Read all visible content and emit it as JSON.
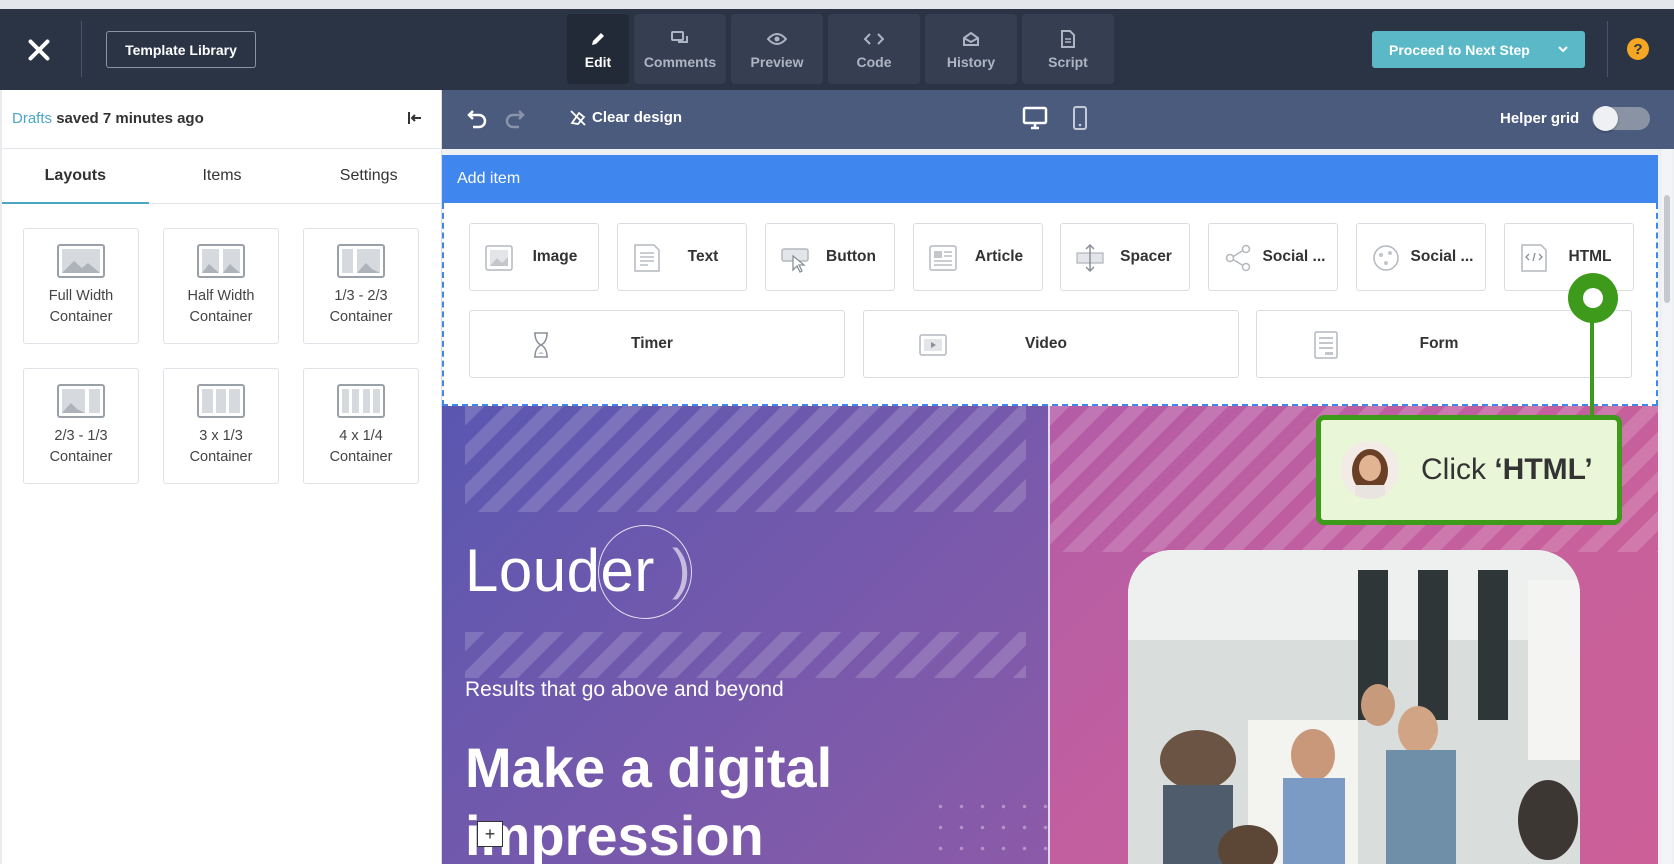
{
  "topbar": {
    "template_library": "Template Library",
    "tabs": [
      {
        "label": "Edit",
        "icon": "pencil-icon",
        "active": true
      },
      {
        "label": "Comments",
        "icon": "comments-icon",
        "active": false
      },
      {
        "label": "Preview",
        "icon": "eye-icon",
        "active": false
      },
      {
        "label": "Code",
        "icon": "code-icon",
        "active": false
      },
      {
        "label": "History",
        "icon": "envelope-open-icon",
        "active": false
      },
      {
        "label": "Script",
        "icon": "document-icon",
        "active": false
      }
    ],
    "proceed": "Proceed to Next Step",
    "help": "?",
    "accent_color": "#5bb8c6"
  },
  "left_panel": {
    "drafts_link": "Drafts",
    "saved_status": "saved 7 minutes ago",
    "tabs": [
      "Layouts",
      "Items",
      "Settings"
    ],
    "active_tab": "Layouts",
    "layouts": [
      {
        "label": "Full Width\nContainer",
        "icon": "full-width-layout-icon"
      },
      {
        "label": "Half Width\nContainer",
        "icon": "half-width-layout-icon"
      },
      {
        "label": "1/3 - 2/3\nContainer",
        "icon": "one-third-two-thirds-layout-icon"
      },
      {
        "label": "2/3 - 1/3\nContainer",
        "icon": "two-thirds-one-third-layout-icon"
      },
      {
        "label": "3 x 1/3\nContainer",
        "icon": "three-columns-layout-icon"
      },
      {
        "label": "4 x 1/4\nContainer",
        "icon": "four-columns-layout-icon"
      }
    ]
  },
  "editor_toolbar": {
    "clear_design": "Clear design",
    "helper_grid": "Helper grid",
    "helper_grid_on": false
  },
  "add_item": {
    "title": "Add item",
    "items_row1": [
      {
        "label": "Image",
        "icon": "image-icon"
      },
      {
        "label": "Text",
        "icon": "text-icon"
      },
      {
        "label": "Button",
        "icon": "button-icon"
      },
      {
        "label": "Article",
        "icon": "article-icon"
      },
      {
        "label": "Spacer",
        "icon": "spacer-icon"
      },
      {
        "label": "Social ...",
        "icon": "share-icon"
      },
      {
        "label": "Social ...",
        "icon": "social-circle-icon"
      },
      {
        "label": "HTML",
        "icon": "html-code-icon"
      }
    ],
    "items_row2": [
      {
        "label": "Timer",
        "icon": "hourglass-icon"
      },
      {
        "label": "Video",
        "icon": "video-icon"
      },
      {
        "label": "Form",
        "icon": "form-icon"
      }
    ],
    "accent_color": "#3f86ee"
  },
  "preview": {
    "logo_text": "Louder",
    "logo_bracket": ")",
    "tagline": "Results that go above and beyond",
    "headline": "Make a digital impression",
    "add_button": "+"
  },
  "tour": {
    "prefix": "Click ",
    "target": "‘HTML’",
    "color": "#3e9a1a"
  }
}
